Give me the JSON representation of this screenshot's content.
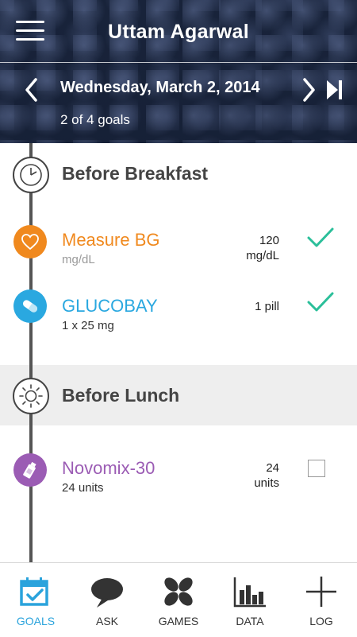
{
  "header": {
    "menu_icon": "hamburger-menu-icon",
    "user_name": "Uttam Agarwal",
    "date": "Wednesday, March 2, 2014",
    "goals_summary": "2 of 4 goals",
    "prev_icon": "chevron-left-icon",
    "next_icon": "chevron-right-icon",
    "today_icon": "play-forward-icon"
  },
  "sections": [
    {
      "title": "Before Breakfast",
      "icon": "clock-icon",
      "items": [
        {
          "name": "Measure BG",
          "sub": "mg/dL",
          "amount_value": "120",
          "amount_unit": "mg/dL",
          "icon": "heart-icon",
          "color": "#f0891e",
          "done": true
        },
        {
          "name": "GLUCOBAY",
          "sub": "1 x 25 mg",
          "amount_value": "1 pill",
          "amount_unit": "",
          "icon": "pill-icon",
          "color": "#2aa8e0",
          "done": true
        }
      ]
    },
    {
      "title": "Before Lunch",
      "icon": "sun-icon",
      "items": [
        {
          "name": "Novomix-30",
          "sub": "24 units",
          "amount_value": "24",
          "amount_unit": "units",
          "icon": "vial-icon",
          "color": "#9b5cb4",
          "done": false
        }
      ]
    }
  ],
  "colors": {
    "check": "#2bbf9a",
    "accent": "#2aa3dc",
    "timeline": "#555555"
  },
  "nav": [
    {
      "label": "GOALS",
      "icon": "calendar-check-icon",
      "active": true
    },
    {
      "label": "ASK",
      "icon": "speech-bubble-icon",
      "active": false
    },
    {
      "label": "GAMES",
      "icon": "clover-icon",
      "active": false
    },
    {
      "label": "DATA",
      "icon": "bar-chart-icon",
      "active": false
    },
    {
      "label": "LOG",
      "icon": "plus-icon",
      "active": false
    }
  ]
}
